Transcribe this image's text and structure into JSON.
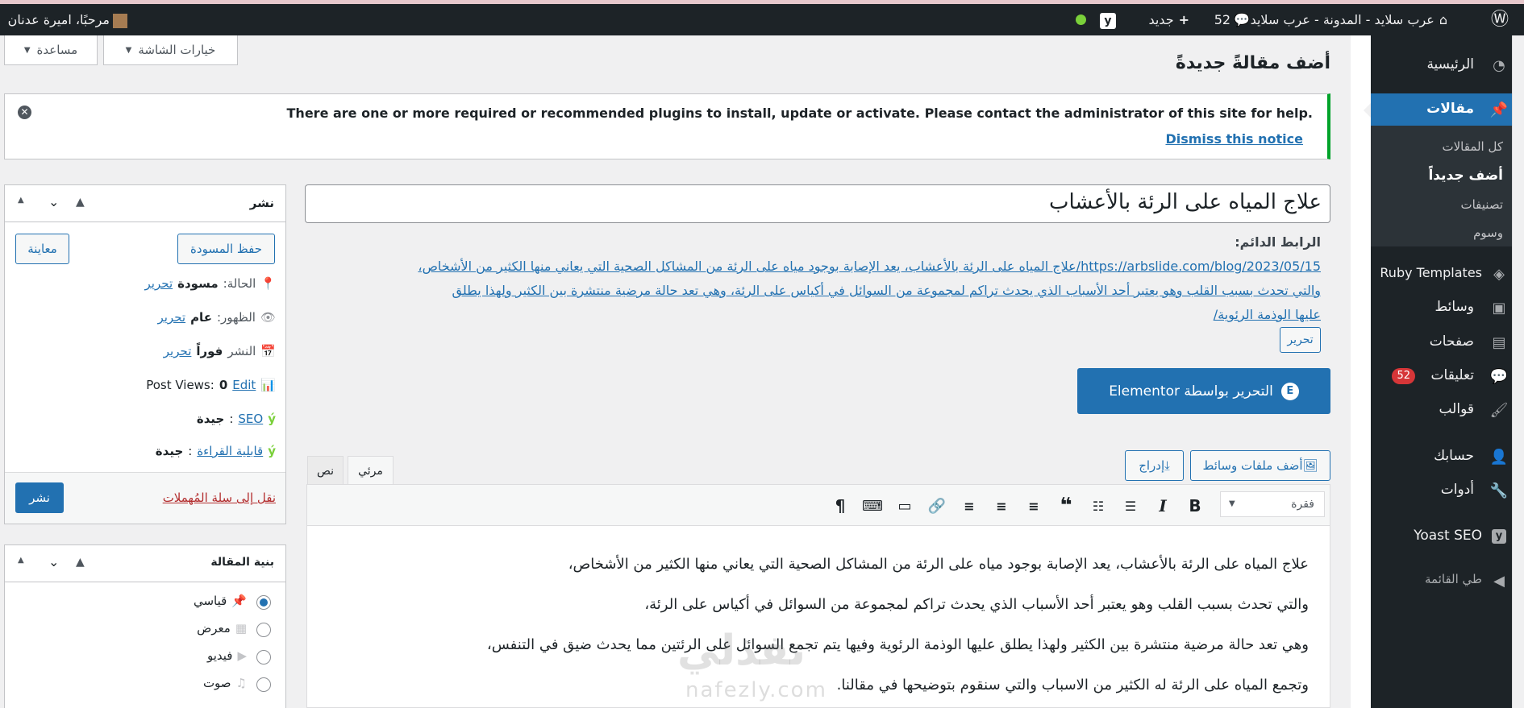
{
  "admin_bar": {
    "site_name": "عرب سلايد - المدونة - عرب سلايد",
    "comments_count": "52",
    "new_label": "جديد",
    "greeting": "مرحبًا، اميرة عدنان"
  },
  "sidebar": {
    "items": [
      {
        "label": "الرئيسية",
        "icon": "dashboard-icon"
      },
      {
        "label": "مقالات",
        "icon": "pin-icon"
      },
      {
        "label": "Ruby Templates",
        "icon": "ruby-icon"
      },
      {
        "label": "وسائط",
        "icon": "media-icon"
      },
      {
        "label": "صفحات",
        "icon": "pages-icon"
      },
      {
        "label": "تعليقات",
        "icon": "comments-icon",
        "badge": "52"
      },
      {
        "label": "قوالب",
        "icon": "appearance-icon"
      },
      {
        "label": "حسابك",
        "icon": "user-icon"
      },
      {
        "label": "أدوات",
        "icon": "tools-icon"
      },
      {
        "label": "Yoast SEO",
        "icon": "yoast-icon"
      },
      {
        "label": "طي القائمة",
        "icon": "collapse-icon"
      }
    ],
    "posts_submenu": [
      "كل المقالات",
      "أضف جديداً",
      "تصنيفات",
      "وسوم"
    ]
  },
  "screen_meta": {
    "screen_options": "خيارات الشاشة",
    "help": "مساعدة"
  },
  "page_title": "أضف مقالةً جديدةً",
  "notice": {
    "text": "There are one or more required or recommended plugins to install, update or activate. Please contact the administrator of this site for help.",
    "dismiss": "Dismiss this notice"
  },
  "post": {
    "title": "علاج المياه على الرئة بالأعشاب",
    "permalink_label": "الرابط الدائم:",
    "permalink_lines": [
      "https://arbslide.com/blog/2023/05/15/علاج المياه على الرئة بالأعشاب، يعد الإصابة بوجود مياه على الرئة من المشاكل الصحية التي يعاني منها الكثير من الأشخاص،",
      "والتي تحدث بسبب القلب وهو يعتبر أحد الأسباب الذي يحدث تراكم لمجموعة من السوائل في أكياس على الرئة، وهي تعد حالة مرضية منتشرة بين الكثير ولهذا يطلق",
      "عليها الوذمة الرئوية/"
    ],
    "edit_permalink": "تحرير",
    "elementor_button": "التحرير بواسطة Elementor",
    "add_media": "أضف ملفات وسائط",
    "insert": "إدراج",
    "tab_visual": "مرئي",
    "tab_text": "نص",
    "format_select": "فقرة",
    "content": [
      "علاج المياه على الرئة بالأعشاب، يعد الإصابة بوجود مياه على الرئة من المشاكل الصحية التي يعاني منها الكثير من الأشخاص،",
      "والتي تحدث بسبب القلب وهو يعتبر أحد الأسباب الذي يحدث تراكم لمجموعة من السوائل في أكياس على الرئة،",
      "وهي تعد حالة مرضية منتشرة بين الكثير ولهذا يطلق عليها الوذمة الرئوية وفيها يتم تجمع السوائل على الرئتين مما يحدث ضيق في التنفس،",
      "وتجمع المياه على الرئة له الكثير من الاسباب والتي سنقوم بتوضيحها في مقالنا."
    ]
  },
  "publish_box": {
    "title": "نشر",
    "save_draft": "حفظ المسودة",
    "preview": "معاينة",
    "status_label": "الحالة:",
    "status_value": "مسودة",
    "visibility_label": "الظهور:",
    "visibility_value": "عام",
    "publish_label": "النشر",
    "publish_value": "فوراً",
    "edit": "تحرير",
    "post_views": "Post Views:",
    "post_views_value": "0",
    "post_views_edit": "Edit",
    "seo_label": "SEO",
    "seo_value": "جيدة",
    "readability_label": "قابلية القراءة",
    "readability_value": "جيدة",
    "trash": "نقل إلى سلة المُهملات",
    "publish_button": "نشر"
  },
  "format_box": {
    "title": "بنية المقالة",
    "options": [
      {
        "label": "قياسي",
        "selected": true
      },
      {
        "label": "معرض",
        "selected": false
      },
      {
        "label": "فيديو",
        "selected": false
      },
      {
        "label": "صوت",
        "selected": false
      }
    ]
  },
  "watermark": {
    "top": "نفذلي",
    "bottom": "nafezly.com"
  },
  "colors": {
    "accent": "#2271b1",
    "dark": "#1d2327",
    "badge": "#d63638",
    "notice": "#00a32a"
  }
}
